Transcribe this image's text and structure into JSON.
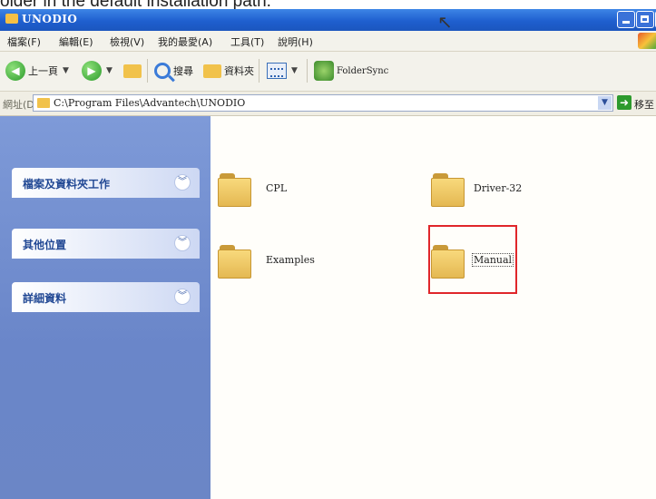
{
  "window": {
    "title": "UNODIO"
  },
  "menu": [
    "檔案(F)",
    "編輯(E)",
    "檢視(V)",
    "我的最愛(A)",
    "工具(T)",
    "說明(H)"
  ],
  "toolbar": {
    "back_label": "上一頁",
    "search_label": "搜尋",
    "folders_label": "資料夾",
    "folder_sync_label": "FolderSync"
  },
  "address": {
    "label": "網址(D)",
    "path": "C:\\Program Files\\Advantech\\UNODIO",
    "go_label": "移至"
  },
  "tasks": [
    "檔案及資料夾工作",
    "其他位置",
    "詳細資料"
  ],
  "folders": [
    "CPL",
    "Driver-32",
    "Examples",
    "Manual"
  ]
}
